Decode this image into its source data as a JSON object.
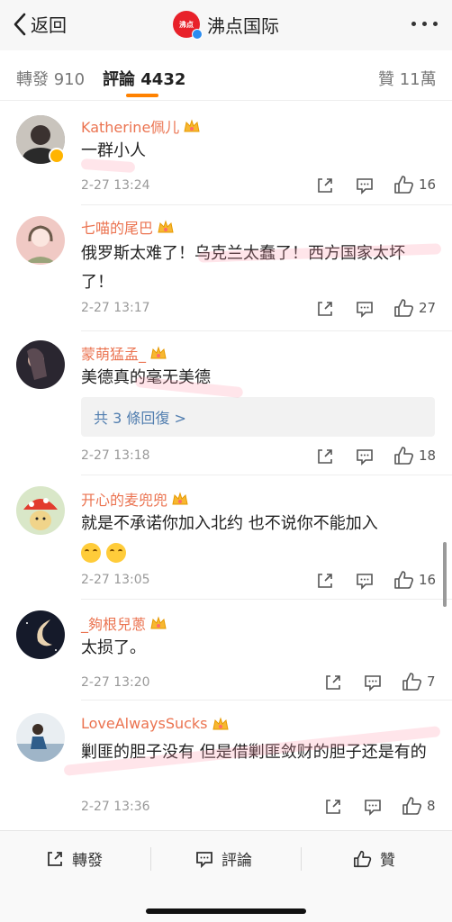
{
  "nav": {
    "back_label": "返回",
    "title": "沸点国际",
    "logo_text": "沸点"
  },
  "tabs": {
    "repost": "轉發 910",
    "comments": "評論 4432",
    "likes": "贊 11萬"
  },
  "comments": [
    {
      "user": "Katherine佩儿",
      "text": "一群小人",
      "time": "2-27 13:24",
      "likes": "16"
    },
    {
      "user": "七喵的尾巴",
      "text": "俄罗斯太难了！乌克兰太蠢了！西方国家太坏了！",
      "time": "2-27 13:17",
      "likes": "27"
    },
    {
      "user": "蒙萌猛孟_",
      "text": "美德真的毫无美德",
      "replies": "共 3 條回復 >",
      "time": "2-27 13:18",
      "likes": "18"
    },
    {
      "user": "开心的麦兜兜",
      "text": "就是不承诺你加入北约 也不说你不能加入",
      "time": "2-27 13:05",
      "likes": "16"
    },
    {
      "user": "_夠根兒蔥",
      "text": "太损了。",
      "time": "2-27 13:20",
      "likes": "7"
    },
    {
      "user": "LoveAlwaysSucks",
      "text": "剿匪的胆子没有 但是借剿匪敛财的胆子还是有的",
      "time": "2-27 13:36",
      "likes": "8"
    }
  ],
  "bottom": {
    "repost": "轉發",
    "comment": "評論",
    "like": "贊"
  },
  "colors": {
    "accent": "#ff8200",
    "username": "#eb7350",
    "link": "#507daf",
    "logo": "#e8212a"
  }
}
